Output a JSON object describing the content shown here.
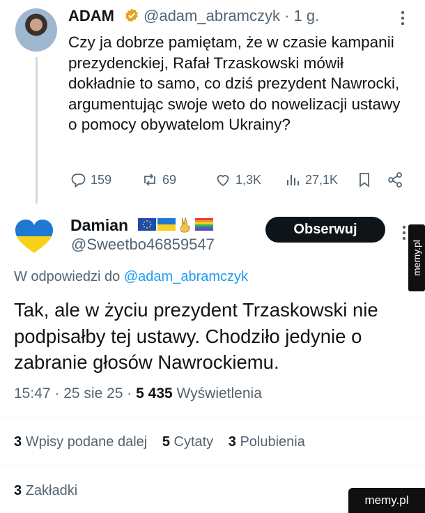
{
  "tweet1": {
    "author_name": "ADAM",
    "handle": "@adam_abramczyk",
    "time": "· 1 g.",
    "text": "Czy ja dobrze pamiętam, że w czasie kampanii prezydenckiej, Rafał Trzaskowski mówił dokładnie to samo, co dziś prezydent Nawrocki, argumentując swoje weto do nowelizacji ustawy o pomocy obywatelom Ukrainy?",
    "replies": "159",
    "reposts": "69",
    "likes": "1,3K",
    "views": "27,1K"
  },
  "tweet2": {
    "author_name": "Damian",
    "handle": "@Sweetbo46859547",
    "follow_label": "Obserwuj",
    "reply_prefix": "W odpowiedzi do",
    "reply_handle": "@adam_abramczyk",
    "text": "Tak, ale w życiu prezydent Trzaskowski nie podpisałby tej ustawy. Chodziło jedynie o zabranie głosów Nawrockiemu.",
    "time": "15:47 · 25 sie 25 ·",
    "views_count": "5 435",
    "views_label": "Wyświetlenia",
    "reposts_count": "3",
    "reposts_label": "Wpisy podane dalej",
    "quotes_count": "5",
    "quotes_label": "Cytaty",
    "likes_count": "3",
    "likes_label": "Polubienia",
    "bookmarks_count": "3",
    "bookmarks_label": "Zakładki"
  },
  "watermark": "memy.pl",
  "colors": {
    "text": "#0f1419",
    "muted": "#536471",
    "link": "#1d9bf0",
    "verified": "#e8a21c",
    "button": "#0f1419"
  }
}
